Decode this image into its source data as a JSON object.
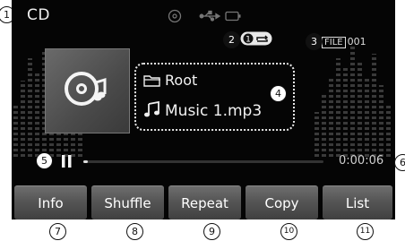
{
  "source": {
    "title": "CD"
  },
  "status": {
    "repeat_icon": "repeat-one-icon",
    "center_icons": [
      "disc-icon",
      "usb-icon",
      "battery-icon"
    ]
  },
  "file_info": {
    "tag": "FILE",
    "number": "001"
  },
  "track": {
    "folder": "Root",
    "file": "Music 1.mp3"
  },
  "playback": {
    "state_icon": "pause-icon",
    "progress": 0.02,
    "time": "0:00:06"
  },
  "buttons": [
    {
      "label": "Info"
    },
    {
      "label": "Shuffle"
    },
    {
      "label": "Repeat"
    },
    {
      "label": "Copy"
    },
    {
      "label": "List"
    }
  ],
  "callouts": [
    "1",
    "2",
    "3",
    "4",
    "5",
    "6",
    "7",
    "8",
    "9",
    "10",
    "11"
  ],
  "colors": {
    "screen_bg": "#050505",
    "button_bg": "#555555",
    "text": "#f2f2f2"
  }
}
